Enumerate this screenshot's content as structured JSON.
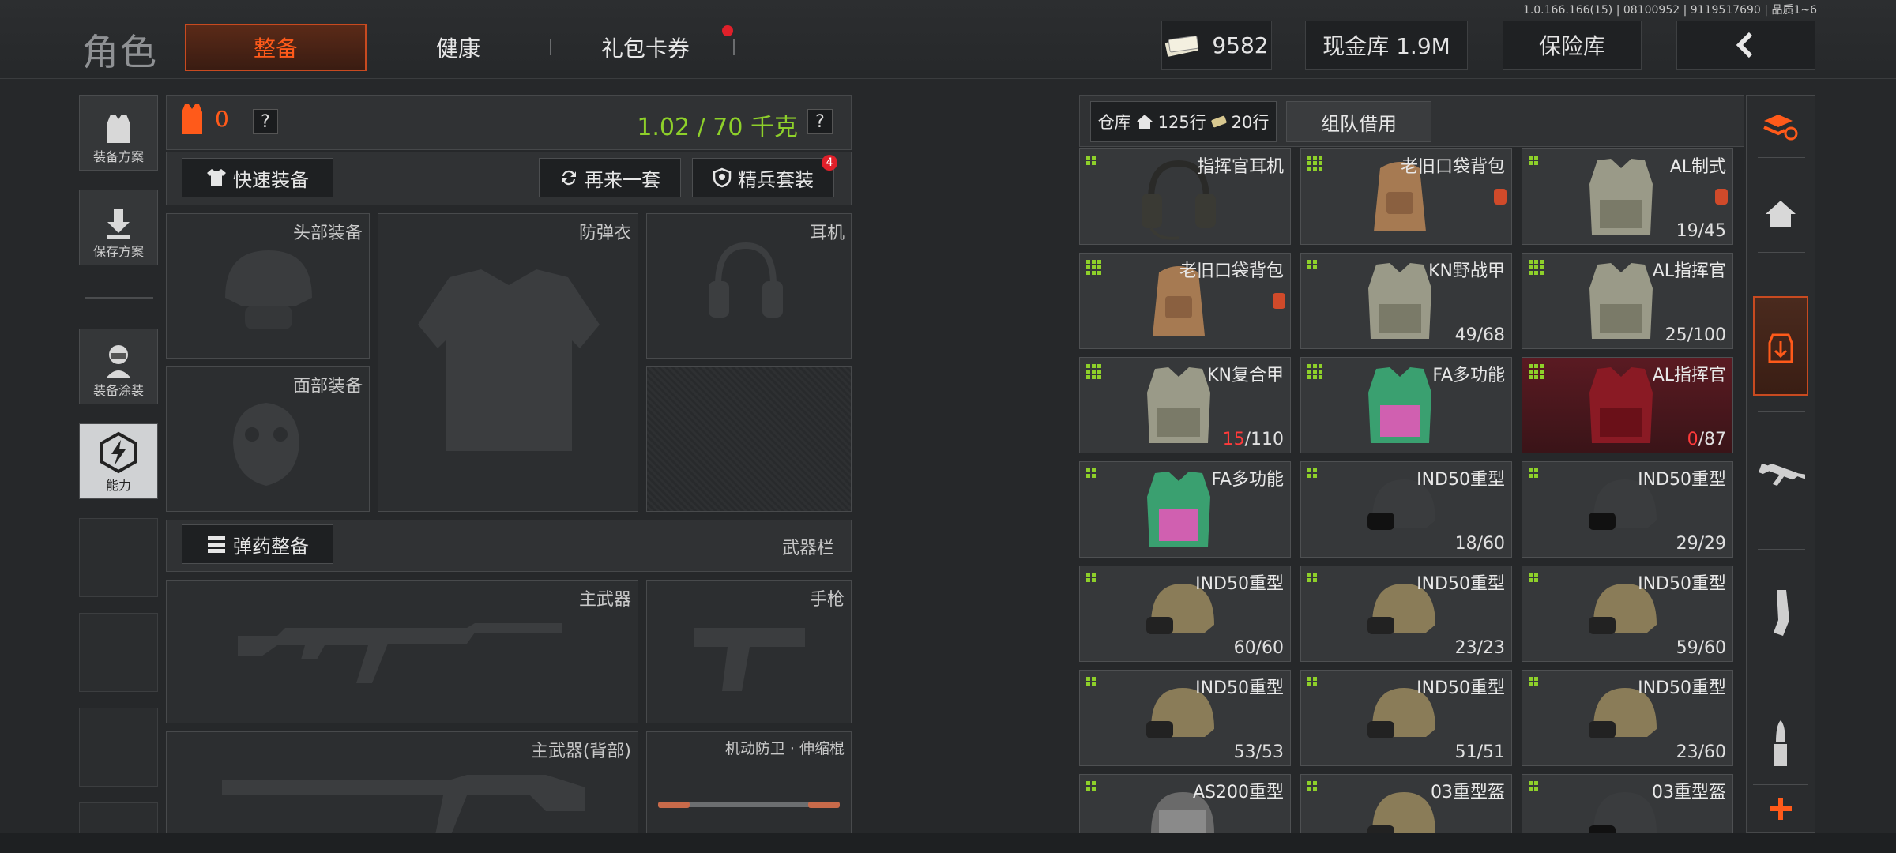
{
  "version_text": "1.0.166.166(15) | 08100952 | 9119517690 | 品质1~6",
  "page_title": "角色",
  "tabs": [
    {
      "label": "整备",
      "active": true
    },
    {
      "label": "健康",
      "active": false
    },
    {
      "label": "礼包卡券",
      "active": false
    }
  ],
  "currency": {
    "amount": "9582",
    "icon": "cash-icon"
  },
  "cash_vault": "现金库 1.9M",
  "insurance": "保险库",
  "left_sidebar": [
    {
      "label": "装备方案",
      "icon": "vest-icon"
    },
    {
      "label": "保存方案",
      "icon": "download-icon"
    },
    {
      "label": "装备涂装",
      "icon": "soldier-icon"
    },
    {
      "label": "能力",
      "icon": "ability-icon",
      "active": true
    }
  ],
  "loadout": {
    "armor_level": "0",
    "weight": "1.02 / 70 千克",
    "quick_equip": "快速装备",
    "again_set": "再来一套",
    "elite_set": "精兵套装",
    "elite_badge": "4",
    "slots": {
      "head": "头部装备",
      "armor": "防弹衣",
      "headset": "耳机",
      "face": "面部装备"
    },
    "ammo_btn": "弹药整备",
    "weapon_bar": "武器栏",
    "primary": "主武器",
    "pistol": "手枪",
    "primary_back": "主武器(背部)",
    "melee": "机动防卫 · 伸缩棍"
  },
  "warehouse": {
    "label": "仓库",
    "rows": "125行",
    "extra_rows": "20行",
    "team_borrow": "组队借用"
  },
  "items": [
    {
      "name": "指挥官耳机",
      "dur": "",
      "dots": 4,
      "kind": "headset"
    },
    {
      "name": "老旧口袋背包",
      "dur": "",
      "dots": 9,
      "kind": "backpack",
      "lock": true
    },
    {
      "name": "AL制式",
      "dur": "19/45",
      "dots": 4,
      "kind": "vest",
      "lock": true
    },
    {
      "name": "老旧口袋背包",
      "dur": "",
      "dots": 9,
      "kind": "backpack",
      "lock": true
    },
    {
      "name": "KN野战甲",
      "dur": "49/68",
      "dots": 4,
      "kind": "vest"
    },
    {
      "name": "AL指挥官",
      "dur": "25/100",
      "dots": 9,
      "kind": "vest"
    },
    {
      "name": "KN复合甲",
      "dur_cur": "15",
      "dur_max": "/110",
      "dots": 9,
      "kind": "vest",
      "cur_red": true
    },
    {
      "name": "FA多功能",
      "dur": "",
      "dots": 9,
      "kind": "pink-vest"
    },
    {
      "name": "AL指挥官",
      "dur_cur": "0",
      "dur_max": "/87",
      "dots": 9,
      "kind": "red-vest",
      "cur_red": true,
      "red": true
    },
    {
      "name": "FA多功能",
      "dur": "",
      "dots": 4,
      "kind": "pink-vest"
    },
    {
      "name": "IND50重型",
      "dur": "18/60",
      "dots": 4,
      "kind": "helmet-dark"
    },
    {
      "name": "IND50重型",
      "dur": "29/29",
      "dots": 4,
      "kind": "helmet-dark"
    },
    {
      "name": "IND50重型",
      "dur": "60/60",
      "dots": 4,
      "kind": "helmet"
    },
    {
      "name": "IND50重型",
      "dur": "23/23",
      "dots": 4,
      "kind": "helmet"
    },
    {
      "name": "IND50重型",
      "dur": "59/60",
      "dots": 4,
      "kind": "helmet"
    },
    {
      "name": "IND50重型",
      "dur": "53/53",
      "dots": 4,
      "kind": "helmet"
    },
    {
      "name": "IND50重型",
      "dur": "51/51",
      "dots": 4,
      "kind": "helmet"
    },
    {
      "name": "IND50重型",
      "dur": "23/60",
      "dots": 4,
      "kind": "helmet"
    },
    {
      "name": "AS200重型",
      "dur": "",
      "dots": 4,
      "kind": "helmet-grey"
    },
    {
      "name": "03重型盔",
      "dur": "",
      "dots": 4,
      "kind": "helmet"
    },
    {
      "name": "03重型盔",
      "dur": "",
      "dots": 4,
      "kind": "helmet-dark"
    }
  ],
  "right_bar": [
    {
      "icon": "layers-refresh-icon"
    },
    {
      "icon": "home-icon"
    },
    {
      "icon": "backpack-download-icon",
      "active": true
    },
    {
      "icon": "rifle-icon"
    },
    {
      "icon": "magazine-icon"
    },
    {
      "icon": "bullet-icon"
    },
    {
      "icon": "plus-icon"
    }
  ],
  "colors": {
    "accent_orange": "#ff5a1a",
    "weight_green": "#8ed02a",
    "badge_red": "#e0202a"
  }
}
